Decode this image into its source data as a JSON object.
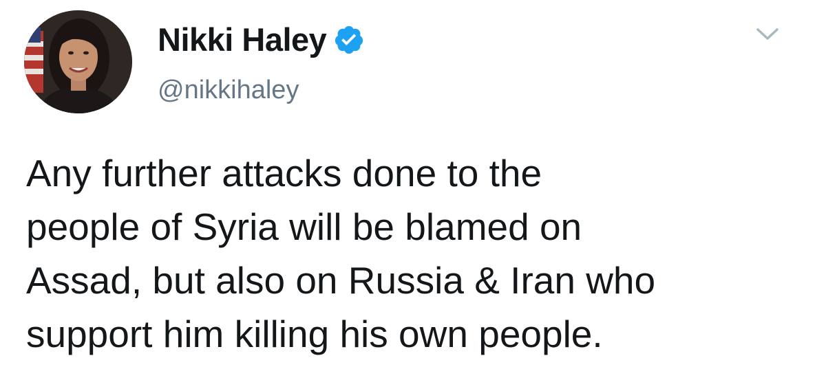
{
  "tweet": {
    "author": {
      "display_name": "Nikki Haley",
      "handle": "@nikkihaley",
      "verified": true,
      "verified_color": "#1DA1F2"
    },
    "text_lines": [
      "Any further attacks done to the",
      "people of Syria will be blamed on",
      "Assad, but also on Russia & Iran who",
      "support him killing his own people."
    ],
    "icons": {
      "avatar": "profile-photo",
      "verified": "verified-badge-icon",
      "menu": "chevron-down-icon"
    },
    "colors": {
      "text": "#14171A",
      "secondary_text": "#657786",
      "background": "#FFFFFF"
    }
  }
}
